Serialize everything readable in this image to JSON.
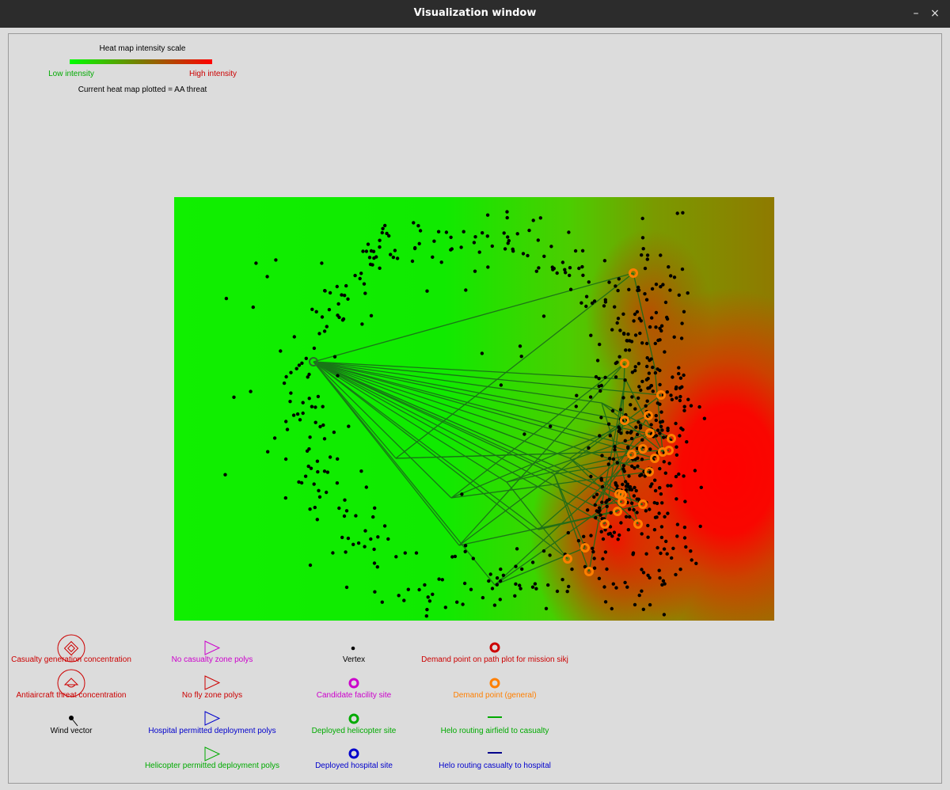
{
  "window": {
    "title": "Visualization window",
    "minimize_glyph": "–",
    "close_glyph": "×"
  },
  "scale": {
    "title": "Heat map intensity scale",
    "low_label": "Low intensity",
    "high_label": "High intensity",
    "current_text": "Current heat map plotted = AA threat",
    "low_color": "#00ff00",
    "high_color": "#ff0000"
  },
  "map": {
    "background_gradient": [
      "#10ef00",
      "#4ccd00",
      "#7a9a00",
      "#ff0000"
    ],
    "vertex_count_approx": 700,
    "airfield_icon": "green-circle-airfield-icon",
    "demand_point_color": "#ff7f00"
  },
  "legend": {
    "casualty_generation": "Casualty generation concentration",
    "antiaircraft_threat": "Antiaircraft threat concentration",
    "wind_vector": "Wind vector",
    "no_casualty_zone": "No casualty zone polys",
    "no_fly_zone": "No fly zone polys",
    "hospital_permitted": "Hospital permitted deployment polys",
    "helicopter_permitted": "Helicopter permitted deployment polys",
    "vertex": "Vertex",
    "candidate_facility": "Candidate facility site",
    "deployed_helicopter": "Deployed helicopter site",
    "deployed_hospital": "Deployed hospital site",
    "demand_point_mission": "Demand point on path plot for mission sikj",
    "demand_point_general": "Demand point (general)",
    "helo_airfield_casualty": "Helo routing airfield to casualty",
    "helo_casualty_hospital": "Helo routing casualty to hospital",
    "colors": {
      "red": "#cc0000",
      "magenta": "#cc00cc",
      "blue": "#0000cc",
      "green": "#00aa00",
      "orange": "#ff7f00",
      "route_green": "#1a7a1a",
      "route_blue": "#00008b"
    }
  }
}
